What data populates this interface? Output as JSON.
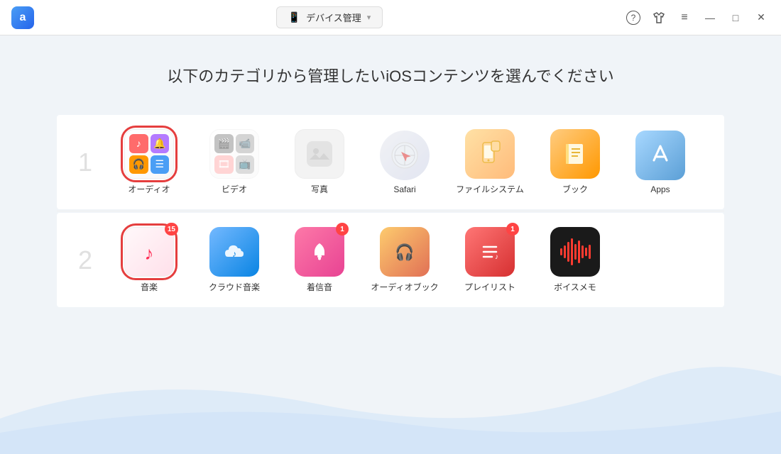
{
  "titlebar": {
    "logo": "a",
    "device_label": "デバイス管理",
    "dropdown_icon": "▾",
    "help_label": "?",
    "shirt_label": "👕",
    "menu_label": "≡",
    "minimize_label": "—",
    "maximize_label": "□",
    "close_label": "✕"
  },
  "page": {
    "title": "以下のカテゴリから管理したいiOSコンテンツを選んでください"
  },
  "row1": {
    "step": "1",
    "items": [
      {
        "id": "audio",
        "label": "オーディオ",
        "selected": true
      },
      {
        "id": "video",
        "label": "ビデオ",
        "selected": false
      },
      {
        "id": "photo",
        "label": "写真",
        "selected": false
      },
      {
        "id": "safari",
        "label": "Safari",
        "selected": false
      },
      {
        "id": "filesystem",
        "label": "ファイルシステム",
        "selected": false
      },
      {
        "id": "book",
        "label": "ブック",
        "selected": false
      },
      {
        "id": "apps",
        "label": "Apps",
        "selected": false
      }
    ]
  },
  "row2": {
    "step": "2",
    "items": [
      {
        "id": "music",
        "label": "音楽",
        "badge": "15",
        "selected": true
      },
      {
        "id": "cloud-music",
        "label": "クラウド音楽",
        "badge": null
      },
      {
        "id": "ringtone",
        "label": "着信音",
        "badge": "1"
      },
      {
        "id": "audiobook",
        "label": "オーディオブック",
        "badge": null
      },
      {
        "id": "playlist",
        "label": "プレイリスト",
        "badge": "1"
      },
      {
        "id": "voicememo",
        "label": "ボイスメモ",
        "badge": null
      }
    ]
  }
}
